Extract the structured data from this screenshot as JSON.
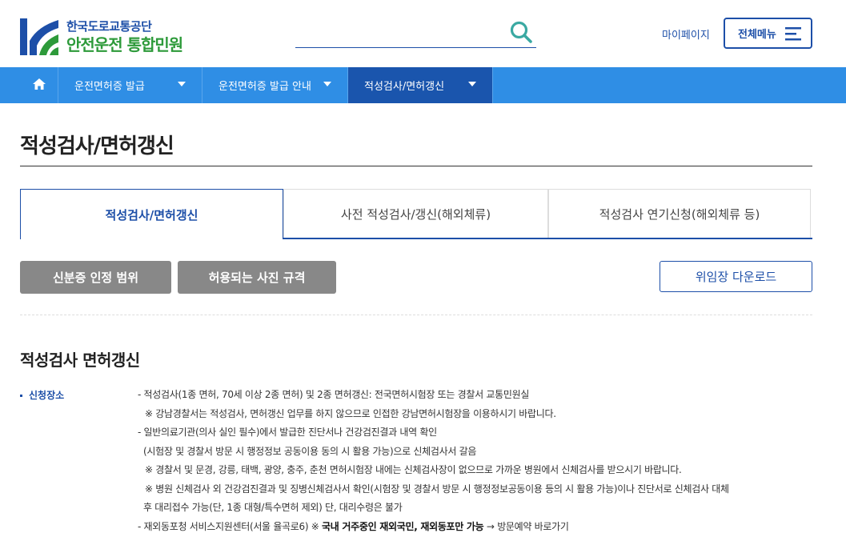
{
  "header": {
    "logo": {
      "line1": "한국도로교통공단",
      "line2": "안전운전 통합민원",
      "colors": {
        "blue": "#1d4fa8",
        "green": "#2d9a3a"
      }
    },
    "search": {
      "value": "",
      "placeholder": ""
    },
    "mypage_label": "마이페이지",
    "allmenu_label": "전체메뉴"
  },
  "nav": {
    "home_icon": "home-icon",
    "items": [
      {
        "label": "운전면허증 발급",
        "active": false
      },
      {
        "label": "운전면허증 발급 안내",
        "active": false
      },
      {
        "label": "적성검사/면허갱신",
        "active": true
      }
    ],
    "colors": {
      "bar": "#2f8ee5",
      "active": "#1a55ad"
    }
  },
  "page": {
    "title": "적성검사/면허갱신"
  },
  "tabs": [
    {
      "label": "적성검사/면허갱신",
      "active": true
    },
    {
      "label": "사전 적성검사/갱신(해외체류)",
      "active": false
    },
    {
      "label": "적성검사 연기신청(해외체류 등)",
      "active": false
    }
  ],
  "buttons": {
    "id_range": "신분증 인정 범위",
    "photo_rules": "허용되는 사진 규격",
    "proxy_download": "위임장 다운로드"
  },
  "section": {
    "title": "적성검사 면허갱신",
    "label": "신청장소",
    "lines": [
      "- 적성검사(1종 면허, 70세 이상 2종 면허) 및 2종 면허갱신: 전국면허시험장 또는 경찰서 교통민원실",
      "※ 강남경찰서는 적성검사, 면허갱신 업무를 하지 않으므로 인접한 강남면허시험장을 이용하시기 바랍니다.",
      "- 일반의료기관(의사 실인 필수)에서 발급한 진단서나 건강검진결과 내역 확인",
      "(시험장 및 경찰서 방문 시 행정정보 공동이용 동의 시 활용 가능)으로 신체검사서 갈음",
      "※ 경찰서 및 문경, 강릉, 태백, 광양, 충주, 춘천 면허시험장 내에는 신체검사장이 없으므로 가까운 병원에서 신체검사를 받으시기 바랍니다.",
      "※ 병원 신체검사 외 건강검진결과 및 징병신체검사서 확인(시험장 및 경찰서 방문 시 행정정보공동이용 등의 시 활용 가능)이나 진단서로 신체검사 대체",
      "후 대리접수 가능(단, 1종 대형/특수면허 제외) 단, 대리수령은 불가"
    ],
    "last_line": {
      "prefix": "- 재외동포청 서비스지원센터(서울 율곡로6) ※ ",
      "bold": "국내 거주중인 재외국민, 재외동포만 가능",
      "suffix": " → 방문예약 바로가기"
    }
  }
}
